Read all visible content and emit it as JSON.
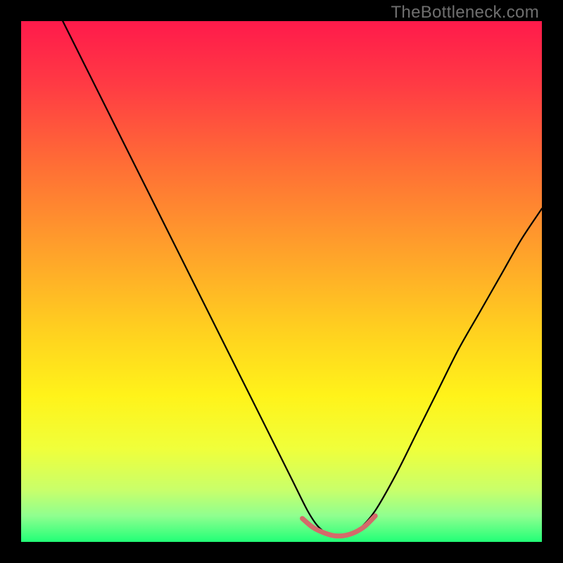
{
  "watermark": "TheBottleneck.com",
  "gradient": {
    "stops": [
      {
        "offset": 0.0,
        "color": "#ff1a4b"
      },
      {
        "offset": 0.12,
        "color": "#ff3a44"
      },
      {
        "offset": 0.28,
        "color": "#ff6f35"
      },
      {
        "offset": 0.45,
        "color": "#ffa42a"
      },
      {
        "offset": 0.6,
        "color": "#ffd21f"
      },
      {
        "offset": 0.72,
        "color": "#fff31a"
      },
      {
        "offset": 0.82,
        "color": "#f0ff3a"
      },
      {
        "offset": 0.9,
        "color": "#c9ff6a"
      },
      {
        "offset": 0.95,
        "color": "#8fff8f"
      },
      {
        "offset": 1.0,
        "color": "#22ff77"
      }
    ]
  },
  "chart_data": {
    "type": "line",
    "title": "",
    "xlabel": "",
    "ylabel": "",
    "xlim": [
      0,
      100
    ],
    "ylim": [
      0,
      100
    ],
    "series": [
      {
        "name": "bottleneck-curve",
        "color": "#000000",
        "width": 2.2,
        "x": [
          8,
          12,
          16,
          20,
          24,
          28,
          32,
          36,
          40,
          44,
          48,
          52,
          55,
          57,
          59,
          61,
          63,
          65,
          68,
          72,
          76,
          80,
          84,
          88,
          92,
          96,
          100
        ],
        "y": [
          100,
          92,
          84,
          76,
          68,
          60,
          52,
          44,
          36,
          28,
          20,
          12,
          6,
          3,
          1.5,
          1,
          1.2,
          2.5,
          6,
          13,
          21,
          29,
          37,
          44,
          51,
          58,
          64
        ]
      },
      {
        "name": "highlight-segment",
        "color": "#d46a6a",
        "width": 7,
        "x": [
          54,
          56,
          58,
          60,
          62,
          64,
          66,
          68
        ],
        "y": [
          4.5,
          2.8,
          1.8,
          1.2,
          1.2,
          1.8,
          3.0,
          5.0
        ]
      }
    ]
  }
}
